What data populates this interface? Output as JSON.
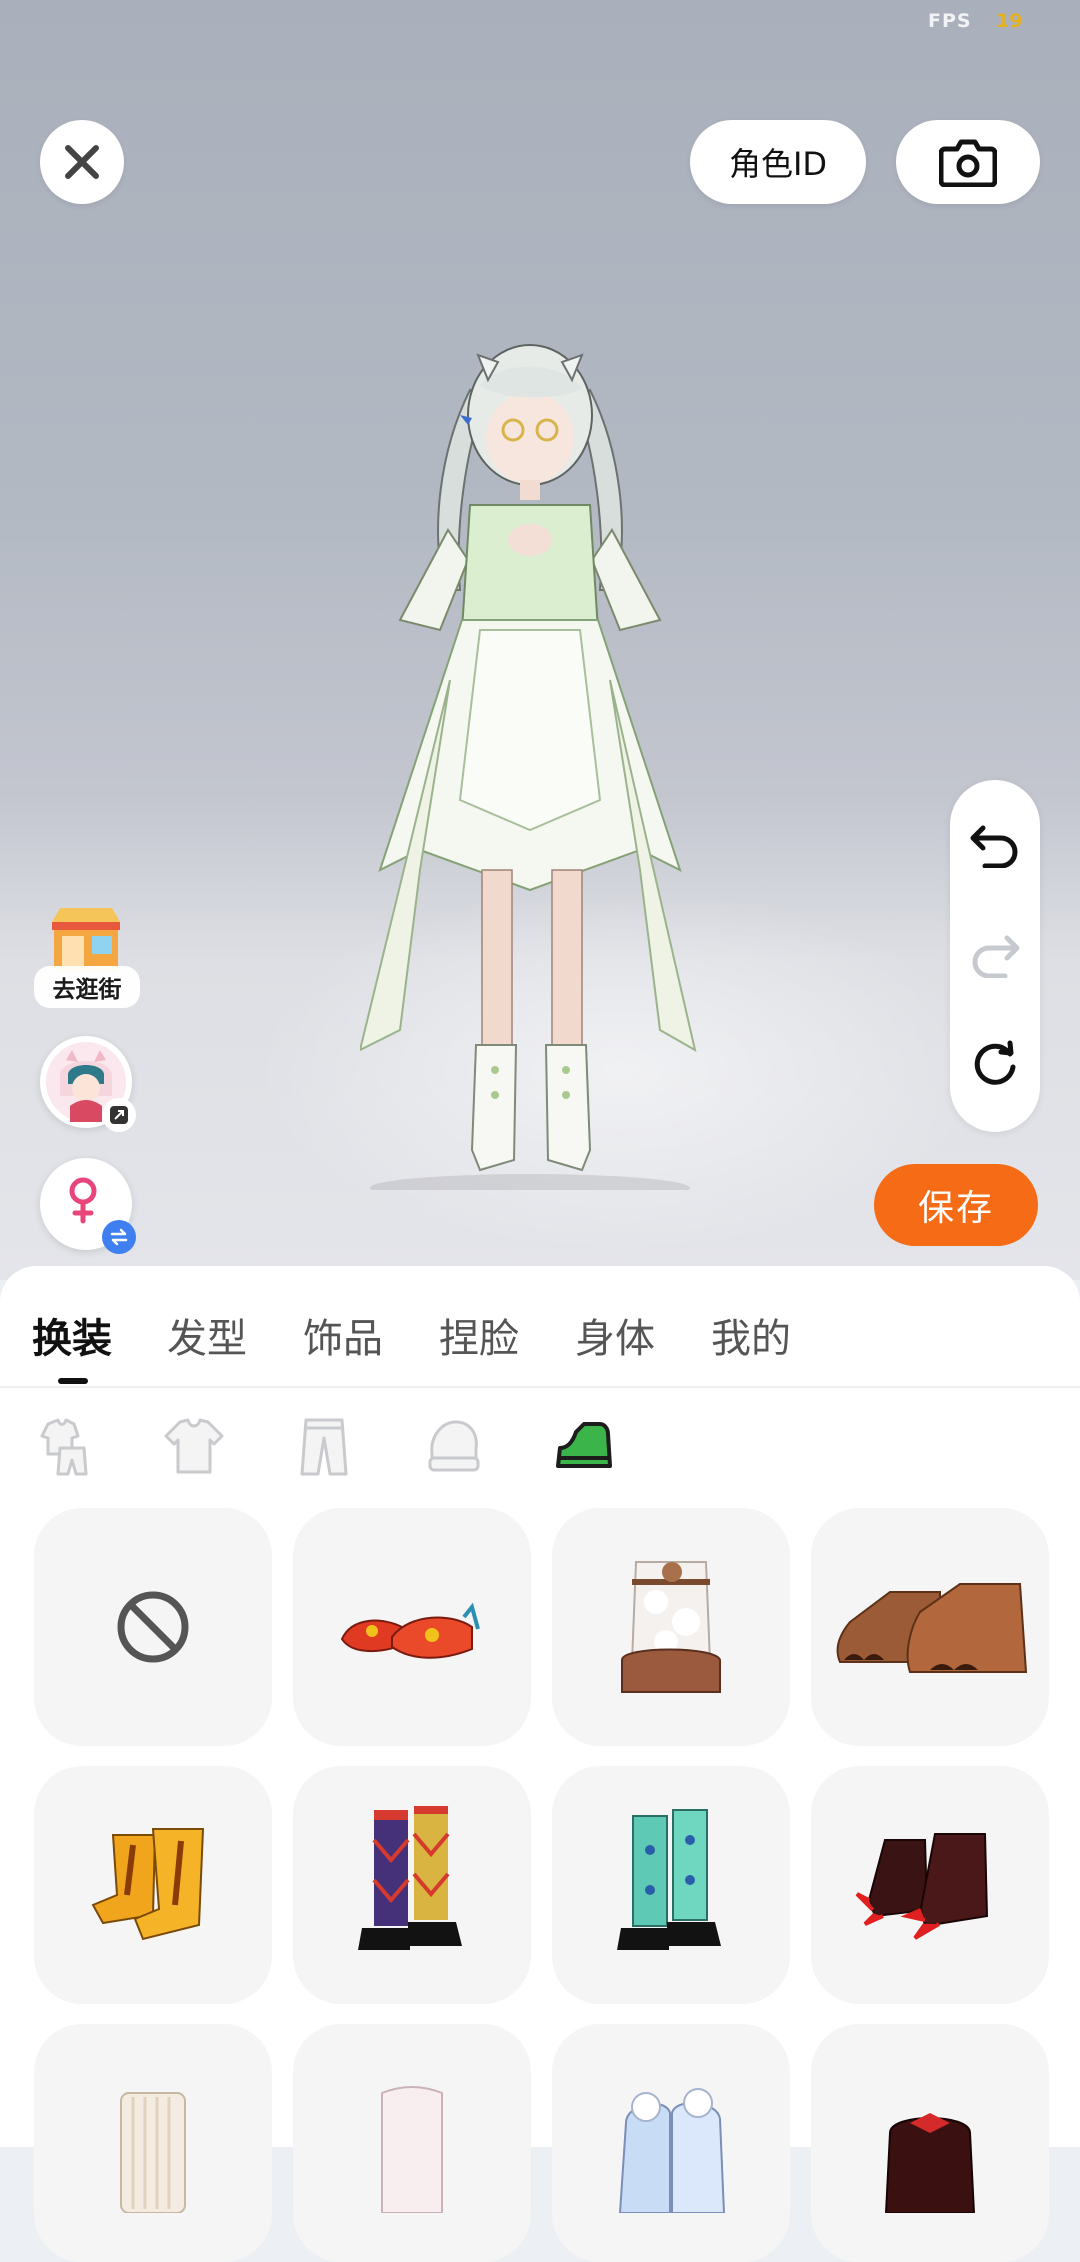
{
  "status": {
    "fps_label": "FPS",
    "fps_value": "19"
  },
  "header": {
    "role_id_label": "角色ID"
  },
  "left_actions": {
    "shop_label": "去逛街"
  },
  "save_label": "保存",
  "tabs": [
    {
      "label": "换装",
      "active": true
    },
    {
      "label": "发型",
      "active": false
    },
    {
      "label": "饰品",
      "active": false
    },
    {
      "label": "捏脸",
      "active": false
    },
    {
      "label": "身体",
      "active": false
    },
    {
      "label": "我的",
      "active": false
    }
  ],
  "subcategories": [
    {
      "icon": "outfit-set-icon",
      "active": false
    },
    {
      "icon": "top-icon",
      "active": false
    },
    {
      "icon": "pants-icon",
      "active": false
    },
    {
      "icon": "gloves-icon",
      "active": false
    },
    {
      "icon": "shoes-icon",
      "active": true
    }
  ],
  "items": [
    {
      "icon": "none-icon"
    },
    {
      "icon": "red-flat-shoes-icon"
    },
    {
      "icon": "fluffy-white-boots-icon"
    },
    {
      "icon": "brown-paw-shoes-icon"
    },
    {
      "icon": "yellow-boots-icon"
    },
    {
      "icon": "argyle-socks-shoes-icon"
    },
    {
      "icon": "teal-socks-shoes-icon"
    },
    {
      "icon": "red-claw-shoes-icon"
    },
    {
      "icon": "cream-knit-socks-icon"
    },
    {
      "icon": "white-boots-icon"
    },
    {
      "icon": "iridescent-boots-icon"
    },
    {
      "icon": "black-red-shoes-icon"
    }
  ],
  "colors": {
    "accent": "#f66b16",
    "fps_value": "#e5b21e",
    "active_subcategory": "#2e9a3a"
  }
}
